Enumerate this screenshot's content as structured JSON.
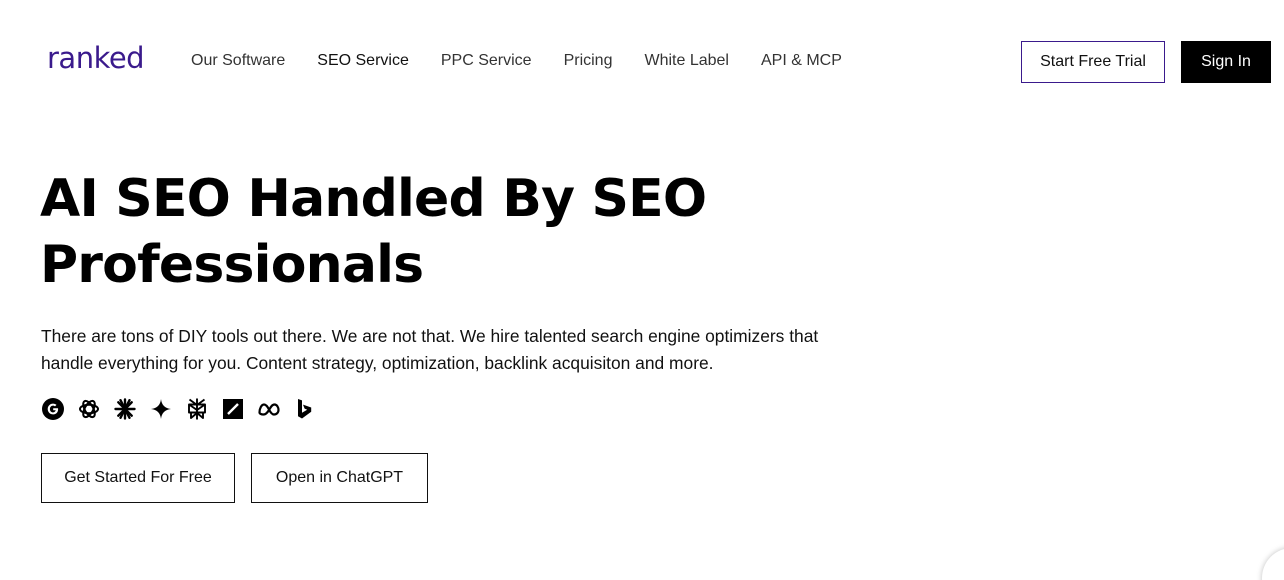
{
  "header": {
    "logo_text": "ranked",
    "nav": [
      {
        "label": "Our Software"
      },
      {
        "label": "SEO Service"
      },
      {
        "label": "PPC Service"
      },
      {
        "label": "Pricing"
      },
      {
        "label": "White Label"
      },
      {
        "label": "API & MCP"
      }
    ],
    "start_trial_label": "Start Free Trial",
    "sign_in_label": "Sign In"
  },
  "hero": {
    "title_line1": "AI SEO Handled By SEO",
    "title_line2": "Professionals",
    "subtitle": "There are tons of DIY tools out there. We are not that. We hire talented search engine optimizers that handle everything for you. Content strategy, optimization, backlink acquisiton and more.",
    "ai_icons": [
      "google-icon",
      "chatgpt-icon",
      "claude-icon",
      "gemini-icon",
      "perplexity-icon",
      "grok-icon",
      "meta-icon",
      "bing-icon"
    ],
    "get_started_label": "Get Started For Free",
    "open_chatgpt_label": "Open in ChatGPT"
  },
  "colors": {
    "brand": "#3a1a8c",
    "text": "#111111",
    "button_dark": "#000000",
    "background": "#ffffff"
  }
}
